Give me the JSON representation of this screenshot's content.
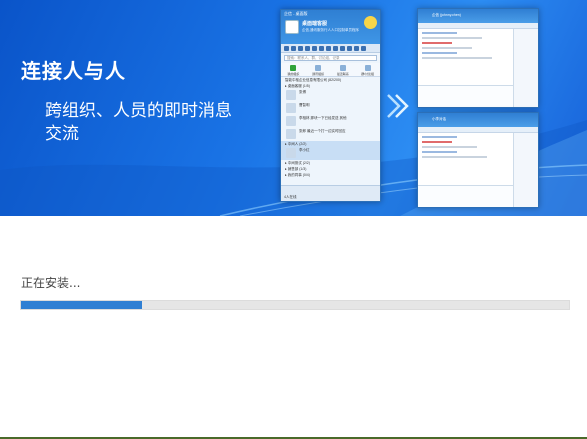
{
  "banner": {
    "title": "连接人与人",
    "subtitle": "跨组织、人员的即时消息交流"
  },
  "preview": {
    "client_window": {
      "title": "企信 - 桌面版",
      "user_name": "桌面端客服",
      "signature": "企信,通讯服务行人人口控制单员程序",
      "search_placeholder": "搜索：联系人、群、讨论组、记录",
      "tabs": [
        "我的组织",
        "通讯组织",
        "最近联系",
        "群/讨论组"
      ],
      "rows": [
        {
          "text": "智能中枢企业信息有限公司 (82/200)",
          "type": "group"
        },
        {
          "text": "▸ 桌面客服 (1/5)",
          "type": "group"
        },
        {
          "text": "张博",
          "type": "contact"
        },
        {
          "text": "曹智明",
          "type": "contact"
        },
        {
          "text": "李相林 那块一下已经发送 其他",
          "type": "contact"
        },
        {
          "text": "张郎 最近一个打一边实时回应",
          "type": "contact"
        },
        {
          "text": "▸ 中间人 (2/2)",
          "type": "group",
          "selected": true
        },
        {
          "text": "李小红",
          "type": "contact",
          "selected": true
        },
        {
          "text": "▸ 中间测试 (2/2)",
          "type": "group"
        },
        {
          "text": "▸ 销售部 (1/3)",
          "type": "group"
        },
        {
          "text": "▸ 我的同事 (0/4)",
          "type": "group"
        }
      ],
      "bottom_label": "4人在线"
    },
    "chat_windows": [
      {
        "title": "企信 (johnny.chen)"
      },
      {
        "title": "小李对话"
      }
    ]
  },
  "install": {
    "status": "正在安装...",
    "progress_percent": 22
  },
  "colors": {
    "banner_blue": "#1a74e6",
    "progress_fill": "#2f7fd3",
    "progress_track": "#e6e6e6"
  }
}
